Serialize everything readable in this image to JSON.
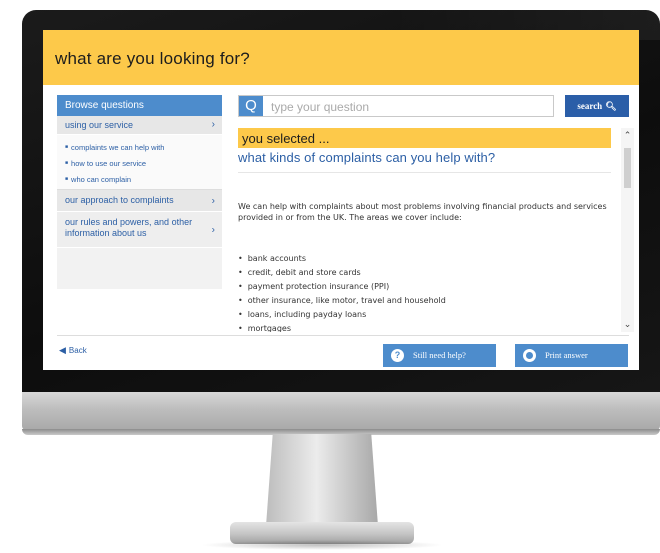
{
  "header": {
    "title": "what are you looking for?"
  },
  "sidebar": {
    "heading": "Browse questions",
    "items": [
      {
        "label": "using our service",
        "chevron": "›"
      },
      {
        "label": "our approach to complaints",
        "chevron": "›"
      },
      {
        "label": "our rules and powers, and other information about us",
        "chevron": "›"
      }
    ],
    "subitems": [
      "complaints we can help with",
      "how to use our service",
      "who can complain"
    ]
  },
  "search": {
    "icon_letter": "Q",
    "placeholder": "type your question",
    "button_label": "search",
    "button_icon": "magnifier-icon"
  },
  "answer": {
    "selected_label": "you selected ...",
    "question": "what kinds of complaints can you help with?",
    "intro": "We can help with complaints about most problems involving financial products and services provided in or from the UK. The areas we cover include:",
    "bullets": [
      "bank accounts",
      "credit, debit and store cards",
      "payment protection insurance (PPI)",
      "other insurance, like motor, travel and household",
      "loans, including payday loans",
      "mortgages"
    ]
  },
  "footer": {
    "back_label": "Back",
    "help_button": "Still need help?",
    "print_button": "Print answer"
  },
  "colors": {
    "header_bg": "#fdc94a",
    "accent_blue": "#4d8ccc",
    "dark_blue": "#2b5ea8",
    "link_blue": "#2c5fa5"
  }
}
